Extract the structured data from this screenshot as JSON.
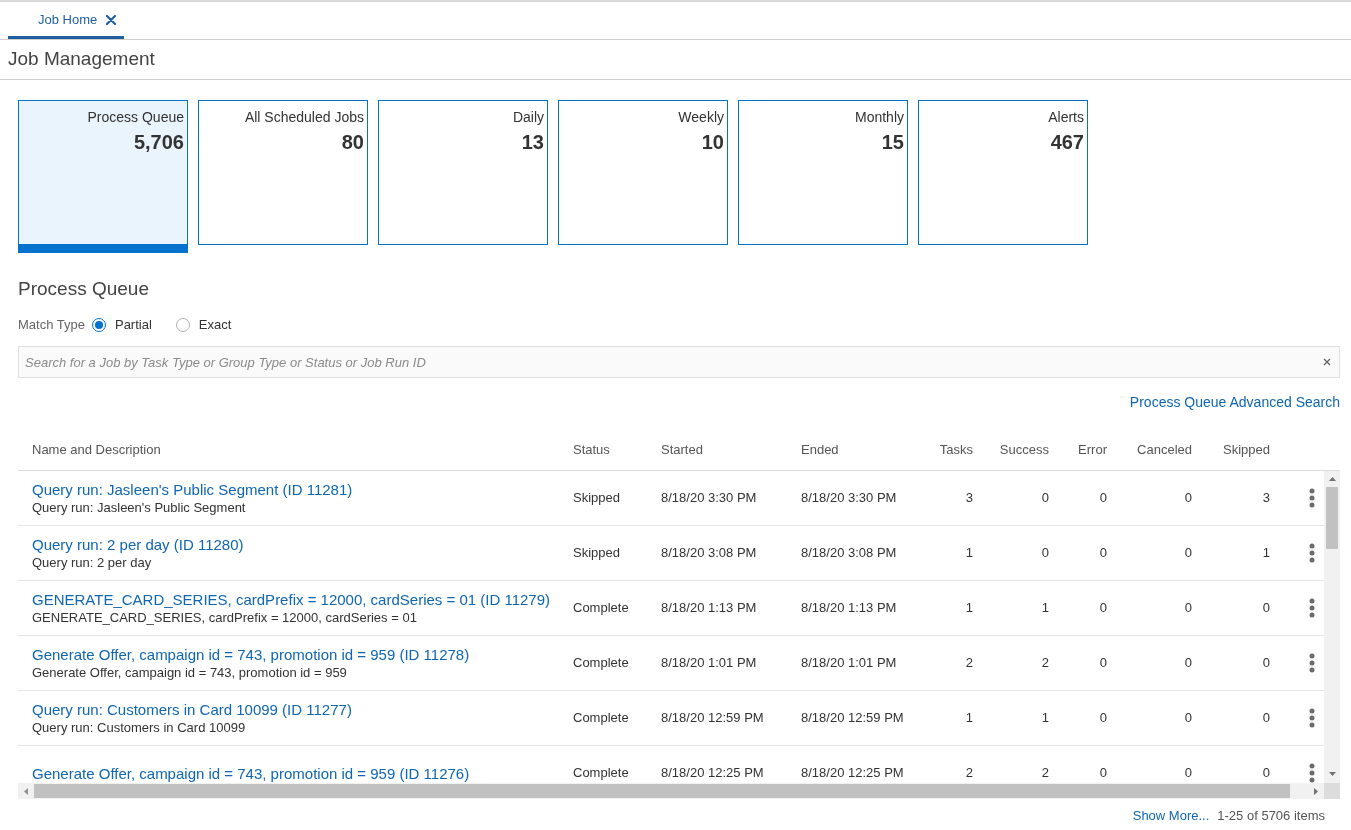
{
  "tabs": [
    {
      "label": "Job Home",
      "selected": true
    }
  ],
  "page": {
    "title": "Job Management"
  },
  "tiles": [
    {
      "label": "Process Queue",
      "value": "5,706",
      "selected": true
    },
    {
      "label": "All Scheduled Jobs",
      "value": "80",
      "selected": false
    },
    {
      "label": "Daily",
      "value": "13",
      "selected": false
    },
    {
      "label": "Weekly",
      "value": "10",
      "selected": false
    },
    {
      "label": "Monthly",
      "value": "15",
      "selected": false
    },
    {
      "label": "Alerts",
      "value": "467",
      "selected": false
    }
  ],
  "process_queue": {
    "title": "Process Queue",
    "match_type": {
      "label": "Match Type",
      "options": [
        {
          "label": "Partial",
          "selected": true
        },
        {
          "label": "Exact",
          "selected": false
        }
      ]
    },
    "search": {
      "placeholder": "Search for a Job by Task Type or Group Type or Status or Job Run ID"
    },
    "advanced_search_link": "Process Queue Advanced Search"
  },
  "table": {
    "columns": [
      "Name and Description",
      "Status",
      "Started",
      "Ended",
      "Tasks",
      "Success",
      "Error",
      "Canceled",
      "Skipped"
    ],
    "rows": [
      {
        "name": "Query run: Jasleen's Public Segment (ID 11281)",
        "description": "Query run: Jasleen's Public Segment",
        "status": "Skipped",
        "started": "8/18/20 3:30 PM",
        "ended": "8/18/20 3:30 PM",
        "tasks": "3",
        "success": "0",
        "error": "0",
        "canceled": "0",
        "skipped": "3"
      },
      {
        "name": "Query run: 2 per day (ID 11280)",
        "description": "Query run: 2 per day",
        "status": "Skipped",
        "started": "8/18/20 3:08 PM",
        "ended": "8/18/20 3:08 PM",
        "tasks": "1",
        "success": "0",
        "error": "0",
        "canceled": "0",
        "skipped": "1"
      },
      {
        "name": "GENERATE_CARD_SERIES, cardPrefix = 12000, cardSeries = 01 (ID 11279)",
        "description": "GENERATE_CARD_SERIES, cardPrefix = 12000, cardSeries = 01",
        "status": "Complete",
        "started": "8/18/20 1:13 PM",
        "ended": "8/18/20 1:13 PM",
        "tasks": "1",
        "success": "1",
        "error": "0",
        "canceled": "0",
        "skipped": "0"
      },
      {
        "name": "Generate Offer, campaign id = 743, promotion id = 959 (ID 11278)",
        "description": "Generate Offer, campaign id = 743, promotion id = 959",
        "status": "Complete",
        "started": "8/18/20 1:01 PM",
        "ended": "8/18/20 1:01 PM",
        "tasks": "2",
        "success": "2",
        "error": "0",
        "canceled": "0",
        "skipped": "0"
      },
      {
        "name": "Query run: Customers in Card 10099 (ID 11277)",
        "description": "Query run: Customers in Card 10099",
        "status": "Complete",
        "started": "8/18/20 12:59 PM",
        "ended": "8/18/20 12:59 PM",
        "tasks": "1",
        "success": "1",
        "error": "0",
        "canceled": "0",
        "skipped": "0"
      },
      {
        "name": "Generate Offer, campaign id = 743, promotion id = 959 (ID 11276)",
        "status": "Complete",
        "started": "8/18/20 12:25 PM",
        "ended": "8/18/20 12:25 PM",
        "tasks": "2",
        "success": "2",
        "error": "0",
        "canceled": "0",
        "skipped": "0"
      }
    ]
  },
  "footer": {
    "show_more": "Show More...",
    "count": "1-25 of 5706 items"
  }
}
